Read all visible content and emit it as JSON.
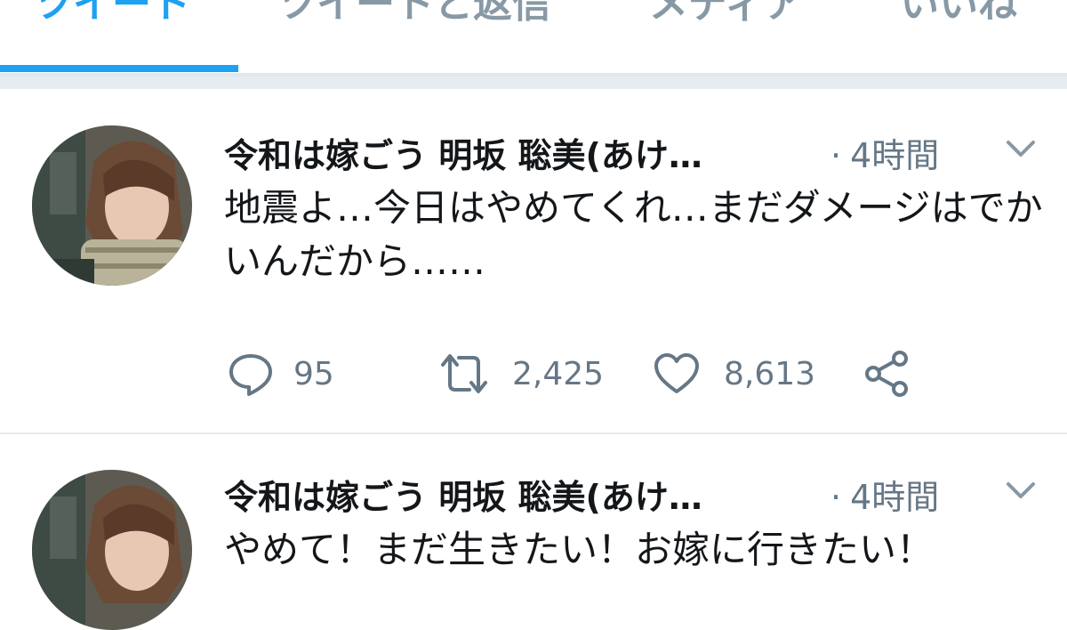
{
  "tabs": [
    {
      "label": "ツイート",
      "active": true
    },
    {
      "label": "ツイートと返信",
      "active": false
    },
    {
      "label": "メディア",
      "active": false
    },
    {
      "label": "いいね",
      "active": false
    }
  ],
  "tweets": [
    {
      "author": "令和は嫁ごう 明坂 聡美(あけ…",
      "dot": "·",
      "time": "4時間",
      "text": "地震よ…今日はやめてくれ…まだダメージはでかいんだから……",
      "replies": "95",
      "retweets": "2,425",
      "likes": "8,613"
    },
    {
      "author": "令和は嫁ごう 明坂 聡美(あけ…",
      "dot": "·",
      "time": "4時間",
      "text": "やめて！まだ生きたい！お嫁に行きたい！"
    }
  ],
  "colors": {
    "accent": "#1da1f2",
    "muted": "#657786",
    "tab_inactive": "#8899a6",
    "divider": "#e6ecf0"
  },
  "icons": {
    "reply": "reply-icon",
    "retweet": "retweet-icon",
    "like": "heart-icon",
    "share": "share-icon",
    "menu": "chevron-down-icon"
  }
}
